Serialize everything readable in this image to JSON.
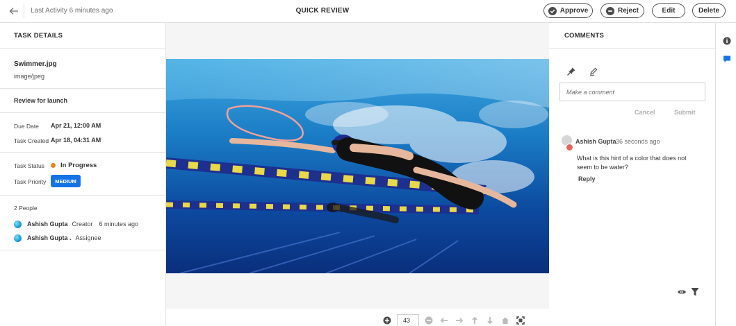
{
  "topbar": {
    "last_activity": "Last Activity 6 minutes ago",
    "title": "QUICK REVIEW",
    "approve_label": "Approve",
    "reject_label": "Reject",
    "edit_label": "Edit",
    "delete_label": "Delete"
  },
  "task": {
    "header": "TASK DETAILS",
    "file_name": "Swimmer.jpg",
    "file_type": "image/jpeg",
    "review_title": "Review for launch",
    "due_date_label": "Due Date",
    "due_date": "Apr 21, 12:00 AM",
    "created_label": "Task Created",
    "created": "Apr 18, 04:31 AM",
    "status_label": "Task Status",
    "status": "In Progress",
    "status_color": "#e68619",
    "priority_label": "Task Priority",
    "priority": "MEDIUM",
    "people_count": "2 People",
    "people": [
      {
        "name": "Ashish Gupta",
        "role": "Creator",
        "time": "6 minutes ago"
      },
      {
        "name": "Ashish Gupta .",
        "role": "Assignee"
      }
    ]
  },
  "viewer": {
    "zoom": "43"
  },
  "comments": {
    "header": "COMMENTS",
    "placeholder": "Make a comment",
    "cancel_label": "Cancel",
    "submit_label": "Submit",
    "items": [
      {
        "author": "Ashish Gupta",
        "time": "36 seconds ago",
        "text": "What is this hint of a color that does not seem to be water?",
        "reply_label": "Reply"
      }
    ]
  },
  "icons": {
    "back": "arrow-left-icon",
    "approve": "check-circle-icon",
    "reject": "minus-circle-icon",
    "pin": "pin-icon",
    "pencil": "pencil-icon",
    "eye": "eye-icon",
    "filter": "filter-icon",
    "info": "info-icon",
    "chat": "chat-icon"
  },
  "colors": {
    "accent": "#1473e6",
    "annotation": "#f0a09a"
  }
}
